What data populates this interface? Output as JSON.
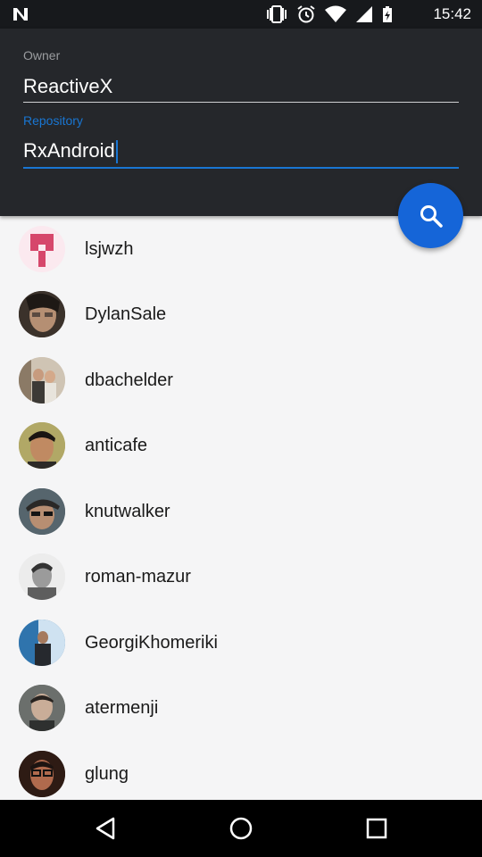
{
  "status_bar": {
    "time": "15:42",
    "icons": [
      "vibrate-icon",
      "alarm-icon",
      "wifi-icon",
      "signal-icon",
      "battery-charging-icon"
    ]
  },
  "form": {
    "owner_label": "Owner",
    "owner_value": "ReactiveX",
    "repository_label": "Repository",
    "repository_value": "RxAndroid"
  },
  "search_button": {
    "icon": "search-icon"
  },
  "colors": {
    "accent": "#1976d2",
    "fab": "#1565d8",
    "header_bg": "#25272b",
    "list_bg": "#f5f5f6"
  },
  "contributors": [
    {
      "name": "lsjwzh"
    },
    {
      "name": "DylanSale"
    },
    {
      "name": "dbachelder"
    },
    {
      "name": "anticafe"
    },
    {
      "name": "knutwalker"
    },
    {
      "name": "roman-mazur"
    },
    {
      "name": "GeorgiKhomeriki"
    },
    {
      "name": "atermenji"
    },
    {
      "name": "glung"
    }
  ],
  "navigation": [
    "back-icon",
    "home-icon",
    "recents-icon"
  ]
}
